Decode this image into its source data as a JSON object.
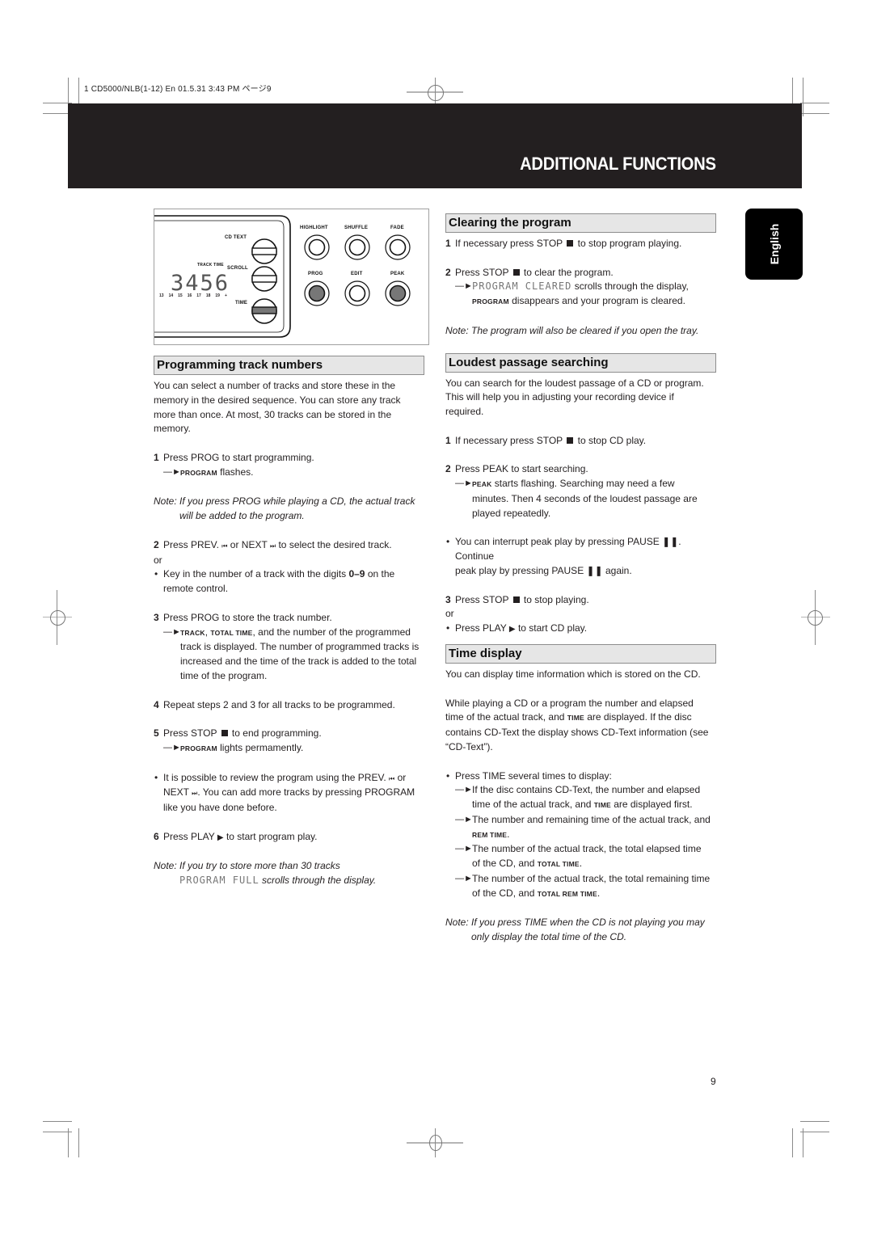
{
  "slug": "1 CD5000/NLB(1-12) En  01.5.31  3:43 PM  ページ9",
  "banner_title": "ADDITIONAL FUNCTIONS",
  "language_tab": "English",
  "page_number": "9",
  "device_illustration": {
    "display_digits": "3456",
    "display_labels": {
      "track_time": "TRACK TIME"
    },
    "track_numbers": [
      "13",
      "14",
      "15",
      "16",
      "17",
      "18",
      "19",
      "+"
    ],
    "side_buttons": [
      "CD TEXT",
      "SCROLL",
      "TIME"
    ],
    "round_buttons_top": [
      "HIGHLIGHT",
      "SHUFFLE",
      "FADE"
    ],
    "round_buttons_bottom": [
      "PROG",
      "EDIT",
      "PEAK"
    ]
  },
  "programming": {
    "title": "Programming track numbers",
    "intro": [
      "You can select a number of tracks and store these in the",
      "memory in the desired sequence. You can store any track",
      "more than once. At most, 30 tracks can be stored in the",
      "memory."
    ],
    "step1": {
      "num": "1",
      "text": "Press PROG to start programming.",
      "result_label": "PROGRAM",
      "result_text": " flashes."
    },
    "note1": {
      "line1": "Note: If you press PROG while playing a CD, the actual track",
      "line2": "will be added to the program."
    },
    "step2": {
      "num": "2",
      "text_a": "Press PREV. ",
      "prev_sym": "⏮",
      "text_b": " or NEXT ",
      "next_sym": "⏭",
      "text_c": " to select the desired track."
    },
    "or1": "or",
    "bullet1": {
      "text_a": "Key in the number of a track with the digits ",
      "digits": "0–9",
      "text_b": " on the",
      "line2": "remote control."
    },
    "step3": {
      "num": "3",
      "text": "Press PROG to store the track number.",
      "result_l1_label1": "TRACK",
      "result_l1_sep": ", ",
      "result_l1_label2": "TOTAL TIME",
      "result_l1_text": ", and the number of the programmed",
      "result_lines": [
        "track is displayed. The number of programmed tracks is",
        "increased and the time of the track is added to the total",
        "time of the program."
      ]
    },
    "step4": {
      "num": "4",
      "text": "Repeat steps 2 and 3 for all tracks to be programmed."
    },
    "step5": {
      "num": "5",
      "text_a": "Press STOP ",
      "text_b": " to end programming.",
      "result_label": "PROGRAM",
      "result_text": " lights permamently."
    },
    "bullet2": {
      "l1_a": "It is possible to review the program using the PREV. ",
      "l1_sym": "⏮",
      "l1_b": " or",
      "l2_a": "NEXT ",
      "l2_sym": "⏭",
      "l2_b": ". You can add more tracks by pressing PROGRAM",
      "l3": "like you have done before."
    },
    "step6": {
      "num": "6",
      "text_a": "Press PLAY ",
      "play_sym": "▶",
      "text_b": " to start program play."
    },
    "note2": {
      "line1": "Note: If you try to store more than 30 tracks",
      "lcd": "PROGRAM FULL",
      "line2": " scrolls through the display."
    }
  },
  "clearing": {
    "title": "Clearing the program",
    "step1": {
      "num": "1",
      "text_a": "If necessary press STOP ",
      "text_b": " to stop program playing."
    },
    "step2": {
      "num": "2",
      "text_a": "Press STOP ",
      "text_b": " to clear the program.",
      "lcd": "PROGRAM CLEARED",
      "result_text": " scrolls through the display,",
      "result_label": "PROGRAM",
      "result_line2": " disappears and your program is cleared."
    },
    "note": "Note: The program will also be cleared if you open the tray."
  },
  "loudest": {
    "title": "Loudest passage searching",
    "intro": [
      "You can search for the loudest passage of a CD or program.",
      "This will help you in adjusting your recording device if",
      "required."
    ],
    "step1": {
      "num": "1",
      "text_a": "If necessary press STOP ",
      "text_b": " to stop CD play."
    },
    "step2": {
      "num": "2",
      "text": "Press PEAK to start searching.",
      "result_label": "PEAK",
      "result_text": " starts flashing. Searching may need a few",
      "result_lines": [
        "minutes. Then 4 seconds of the loudest passage are",
        "played repeatedly."
      ]
    },
    "bullet1": {
      "l1": "You can interrupt peak play by pressing PAUSE ❚❚. Continue",
      "l2": "peak play by pressing PAUSE ❚❚ again."
    },
    "step3": {
      "num": "3",
      "text_a": "Press STOP ",
      "text_b": " to stop playing."
    },
    "or": "or",
    "bullet2": {
      "text_a": "Press PLAY ",
      "play_sym": "▶",
      "text_b": " to start CD play."
    }
  },
  "time_display": {
    "title": "Time display",
    "intro": "You can display time information which is stored on the CD.",
    "para_l1": "While playing a CD or a program the number and elapsed",
    "para_l2_a": "time of the actual track, and ",
    "para_l2_label": "TIME",
    "para_l2_b": " are displayed. If the disc",
    "para_l3": "contains CD-Text the display shows CD-Text information (see",
    "para_l4": "“CD-Text”).",
    "bullet": "Press TIME several times to display:",
    "results": [
      {
        "l1": "If the disc contains CD-Text, the number and elapsed",
        "l2_a": "time of the actual track, and ",
        "l2_label": "TIME",
        "l2_b": " are displayed first."
      },
      {
        "l1": "The number and remaining time of the actual track, and",
        "l2_a": "",
        "l2_label": "REM TIME",
        "l2_b": "."
      },
      {
        "l1": "The number of the actual track, the total elapsed time",
        "l2_a": "of the CD, and ",
        "l2_label": "TOTAL TIME",
        "l2_b": "."
      },
      {
        "l1": "The number of the actual track, the total remaining time",
        "l2_a": "of the CD, and ",
        "l2_label": "TOTAL REM TIME",
        "l2_b": "."
      }
    ],
    "note_l1": "Note: If you press TIME when the CD is not playing you may",
    "note_l2": "only display the total time of the CD."
  },
  "symbols": {
    "result_arrow": "—►",
    "bullet": "•"
  }
}
